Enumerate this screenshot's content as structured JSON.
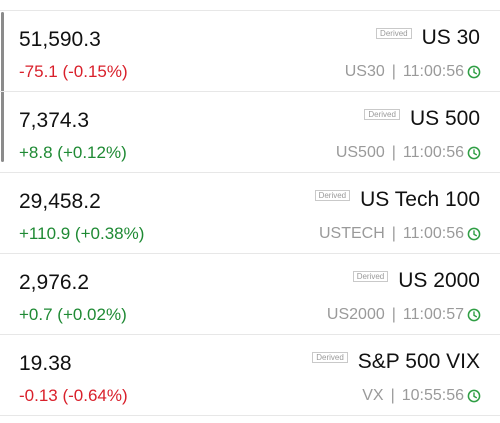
{
  "quotes": [
    {
      "price": "51,590.3",
      "change": "-75.1 (-0.15%)",
      "direction": "down",
      "badge": "Derived",
      "name": "US 30",
      "symbol": "US30",
      "time": "11:00:56"
    },
    {
      "price": "7,374.3",
      "change": "+8.8 (+0.12%)",
      "direction": "up",
      "badge": "Derived",
      "name": "US 500",
      "symbol": "US500",
      "time": "11:00:56"
    },
    {
      "price": "29,458.2",
      "change": "+110.9 (+0.38%)",
      "direction": "up",
      "badge": "Derived",
      "name": "US Tech 100",
      "symbol": "USTECH",
      "time": "11:00:56"
    },
    {
      "price": "2,976.2",
      "change": "+0.7 (+0.02%)",
      "direction": "up",
      "badge": "Derived",
      "name": "US 2000",
      "symbol": "US2000",
      "time": "11:00:57"
    },
    {
      "price": "19.38",
      "change": "-0.13 (-0.64%)",
      "direction": "down",
      "badge": "Derived",
      "name": "S&P 500 VIX",
      "symbol": "VX",
      "time": "10:55:56"
    }
  ],
  "separator": "|",
  "icons": {
    "time": "clock-icon"
  },
  "colors": {
    "down": "#d9202b",
    "up": "#1f8a34",
    "muted": "#9a9a9a",
    "clock": "#2f9e44"
  }
}
